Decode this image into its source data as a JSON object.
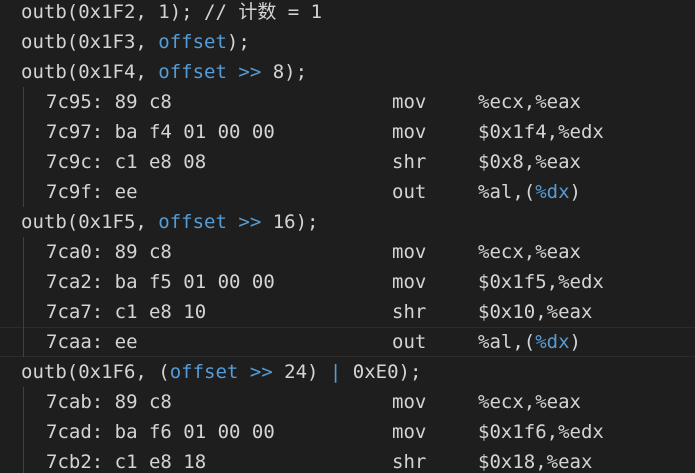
{
  "lines": [
    {
      "kind": "src",
      "parts": [
        {
          "t": "outb(0x1F2, 1); // 计数 = 1",
          "c": ""
        }
      ]
    },
    {
      "kind": "src",
      "parts": [
        {
          "t": "outb(0x1F3, ",
          "c": ""
        },
        {
          "t": "offset",
          "c": "kw"
        },
        {
          "t": ");",
          "c": ""
        }
      ]
    },
    {
      "kind": "src",
      "parts": [
        {
          "t": "outb(0x1F4, ",
          "c": ""
        },
        {
          "t": "offset",
          "c": "kw"
        },
        {
          "t": " ",
          "c": ""
        },
        {
          "t": ">>",
          "c": "kw"
        },
        {
          "t": " 8);",
          "c": ""
        }
      ]
    },
    {
      "kind": "asm",
      "addr": "7c95:",
      "bytes": "89 c8",
      "mnemonic": "mov",
      "operands": [
        {
          "t": "%ecx,%eax",
          "c": ""
        }
      ]
    },
    {
      "kind": "asm",
      "addr": "7c97:",
      "bytes": "ba f4 01 00 00",
      "mnemonic": "mov",
      "operands": [
        {
          "t": "$0x1f4,%edx",
          "c": ""
        }
      ]
    },
    {
      "kind": "asm",
      "addr": "7c9c:",
      "bytes": "c1 e8 08",
      "mnemonic": "shr",
      "operands": [
        {
          "t": "$0x8,%eax",
          "c": ""
        }
      ]
    },
    {
      "kind": "asm",
      "addr": "7c9f:",
      "bytes": "ee",
      "mnemonic": "out",
      "operands": [
        {
          "t": "%al,(",
          "c": ""
        },
        {
          "t": "%dx",
          "c": "kw"
        },
        {
          "t": ")",
          "c": ""
        }
      ]
    },
    {
      "kind": "src",
      "parts": [
        {
          "t": "outb(0x1F5, ",
          "c": ""
        },
        {
          "t": "offset",
          "c": "kw"
        },
        {
          "t": " ",
          "c": ""
        },
        {
          "t": ">>",
          "c": "kw"
        },
        {
          "t": " 16);",
          "c": ""
        }
      ]
    },
    {
      "kind": "asm",
      "addr": "7ca0:",
      "bytes": "89 c8",
      "mnemonic": "mov",
      "operands": [
        {
          "t": "%ecx,%eax",
          "c": ""
        }
      ]
    },
    {
      "kind": "asm",
      "addr": "7ca2:",
      "bytes": "ba f5 01 00 00",
      "mnemonic": "mov",
      "operands": [
        {
          "t": "$0x1f5,%edx",
          "c": ""
        }
      ]
    },
    {
      "kind": "asm",
      "addr": "7ca7:",
      "bytes": "c1 e8 10",
      "mnemonic": "shr",
      "operands": [
        {
          "t": "$0x10,%eax",
          "c": ""
        }
      ]
    },
    {
      "kind": "asm",
      "addr": "7caa:",
      "bytes": "ee",
      "mnemonic": "out",
      "operands": [
        {
          "t": "%al,(",
          "c": ""
        },
        {
          "t": "%dx",
          "c": "kw"
        },
        {
          "t": ")",
          "c": ""
        }
      ],
      "current": true
    },
    {
      "kind": "src",
      "parts": [
        {
          "t": "outb(0x1F6, (",
          "c": ""
        },
        {
          "t": "offset",
          "c": "kw"
        },
        {
          "t": " ",
          "c": ""
        },
        {
          "t": ">>",
          "c": "kw"
        },
        {
          "t": " 24) ",
          "c": ""
        },
        {
          "t": "|",
          "c": "kw"
        },
        {
          "t": " 0xE0);",
          "c": ""
        }
      ]
    },
    {
      "kind": "asm",
      "addr": "7cab:",
      "bytes": "89 c8",
      "mnemonic": "mov",
      "operands": [
        {
          "t": "%ecx,%eax",
          "c": ""
        }
      ]
    },
    {
      "kind": "asm",
      "addr": "7cad:",
      "bytes": "ba f6 01 00 00",
      "mnemonic": "mov",
      "operands": [
        {
          "t": "$0x1f6,%edx",
          "c": ""
        }
      ]
    },
    {
      "kind": "asm",
      "addr": "7cb2:",
      "bytes": "c1 e8 18",
      "mnemonic": "shr",
      "operands": [
        {
          "t": "$0x18,%eax",
          "c": ""
        }
      ]
    }
  ]
}
